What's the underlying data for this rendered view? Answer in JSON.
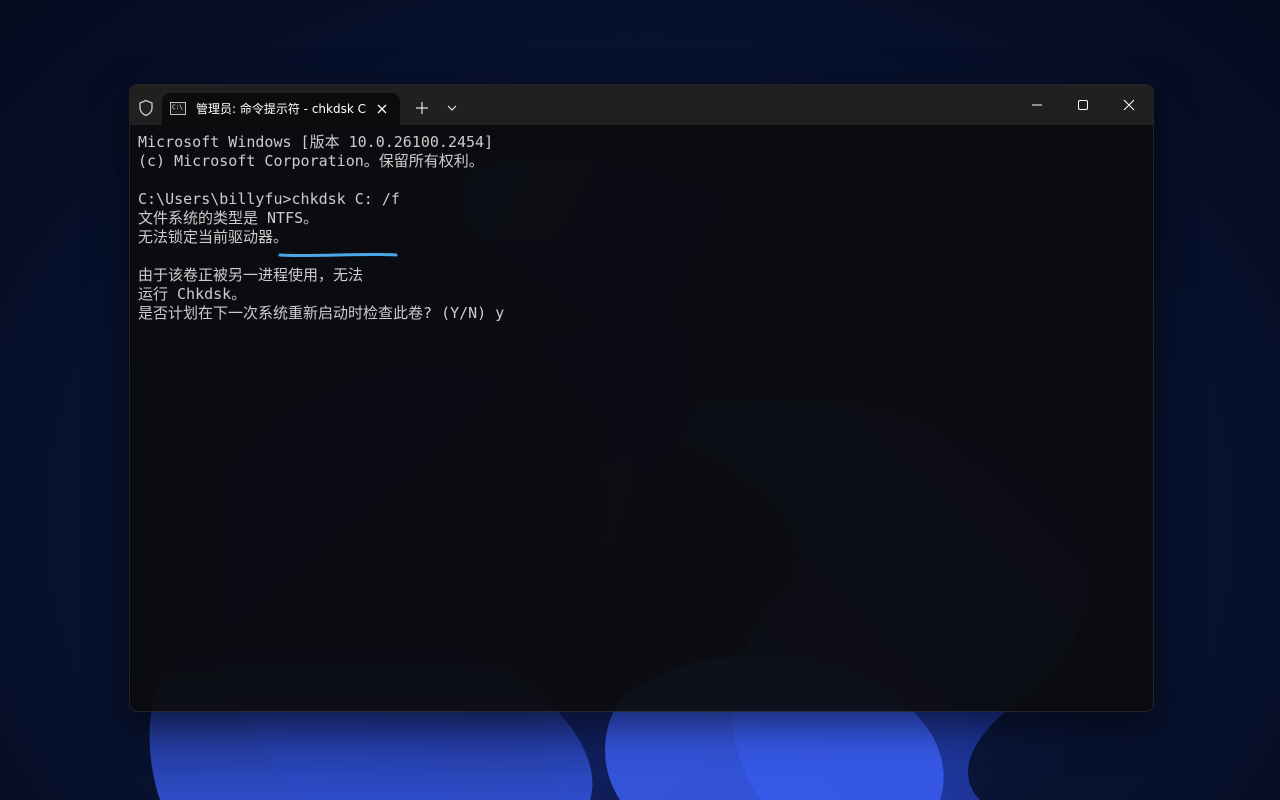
{
  "window": {
    "tab_title": "管理员: 命令提示符 - chkdsk C",
    "tab_icon_text": "C:\\",
    "icons": {
      "shield": "shield-icon",
      "tab": "cmd-icon",
      "tab_close": "close-icon",
      "new_tab": "plus-icon",
      "dropdown": "chevron-down-icon",
      "minimize": "minimize-icon",
      "maximize": "maximize-icon",
      "close": "close-icon"
    }
  },
  "console": {
    "header_line1": "Microsoft Windows [版本 10.0.26100.2454]",
    "header_line2": "(c) Microsoft Corporation。保留所有权利。",
    "prompt": "C:\\Users\\billyfu>",
    "command": "chkdsk C: /f",
    "fs_type": "文件系统的类型是 NTFS。",
    "cannot_lock": "无法锁定当前驱动器。",
    "in_use_line1": "由于该卷正被另一进程使用，无法",
    "in_use_line2": "运行 Chkdsk。",
    "schedule_question": "是否计划在下一次系统重新启动时检查此卷? (Y/N) y"
  },
  "colors": {
    "text": "#cccccc",
    "accent_underline": "#4aa8e8",
    "titlebar": "#202020",
    "tab_active": "#0c0c0c"
  }
}
